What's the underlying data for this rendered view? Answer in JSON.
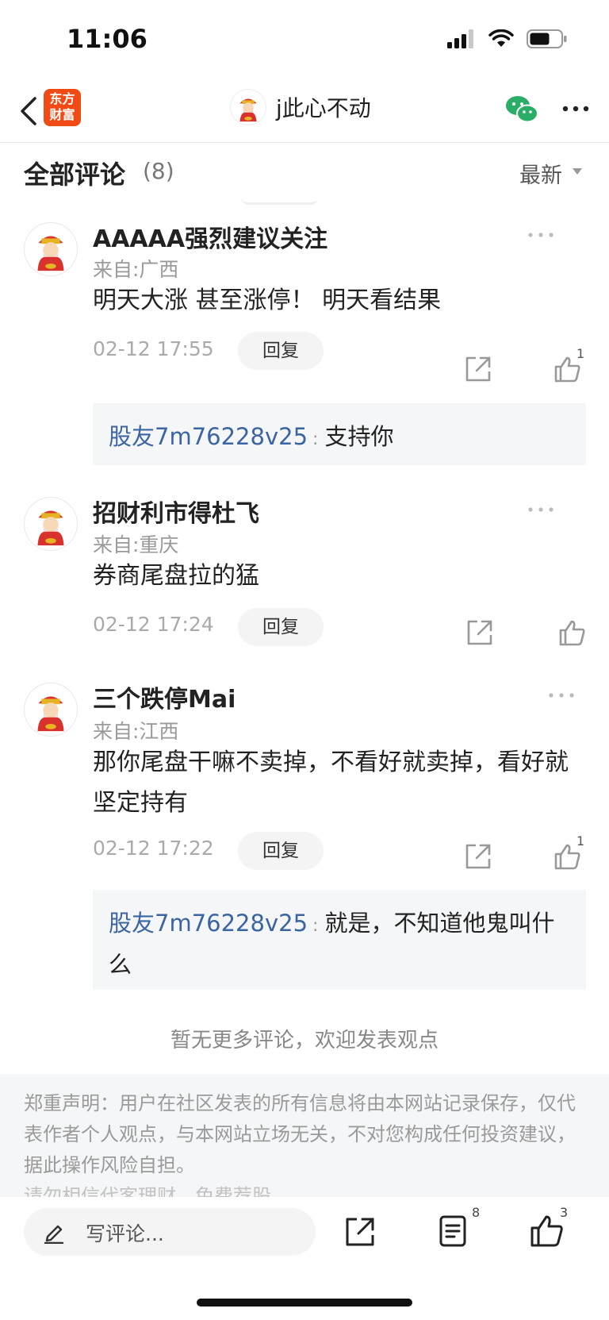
{
  "status_bar": {
    "time": "11:06"
  },
  "nav": {
    "app_logo_text": "东方财富",
    "title": "j此心不动"
  },
  "comments_header": {
    "title": "全部评论",
    "count": "(8)",
    "sort": "最新"
  },
  "comments": [
    {
      "user": "AAAAA强烈建议关注",
      "location": "来自:广西",
      "text": "明天大涨 甚至涨停！ 明天看结果",
      "date": "02-12 17:55",
      "reply_label": "回复",
      "likes": "1",
      "replies": [
        {
          "user": "股友7m76228v25",
          "sep": ":",
          "text": "支持你"
        }
      ]
    },
    {
      "user": "招财利市得杜飞",
      "location": "来自:重庆",
      "text": "券商尾盘拉的猛",
      "date": "02-12 17:24",
      "reply_label": "回复",
      "likes": ""
    },
    {
      "user": "三个跌停Mai",
      "location": "来自:江西",
      "text": "那你尾盘干嘛不卖掉，不看好就卖掉，看好就坚定持有",
      "date": "02-12 17:22",
      "reply_label": "回复",
      "likes": "1",
      "replies": [
        {
          "user": "股友7m76228v25",
          "sep": ":",
          "text": "就是，不知道他鬼叫什么"
        }
      ]
    }
  ],
  "no_more_text": "暂无更多评论，欢迎发表观点",
  "disclaimer": {
    "text": "郑重声明：用户在社区发表的所有信息将由本网站记录保存，仅代表作者个人观点，与本网站立场无关，不对您构成任何投资建议，据此操作风险自担。",
    "cut_line": "请勿相信代客理财、免费荐股"
  },
  "bottom_bar": {
    "write_placeholder": "写评论...",
    "comment_count": "8",
    "like_count": "3"
  },
  "colors": {
    "accent_link": "#3b64a3",
    "app_logo": "#f24a14",
    "wechat": "#2aae67"
  },
  "icons": [
    "back-arrow-icon",
    "wechat-icon",
    "more-dots-icon",
    "share-icon",
    "thumbs-up-icon",
    "pencil-icon",
    "list-icon",
    "signal-icon",
    "wifi-icon",
    "battery-icon"
  ]
}
